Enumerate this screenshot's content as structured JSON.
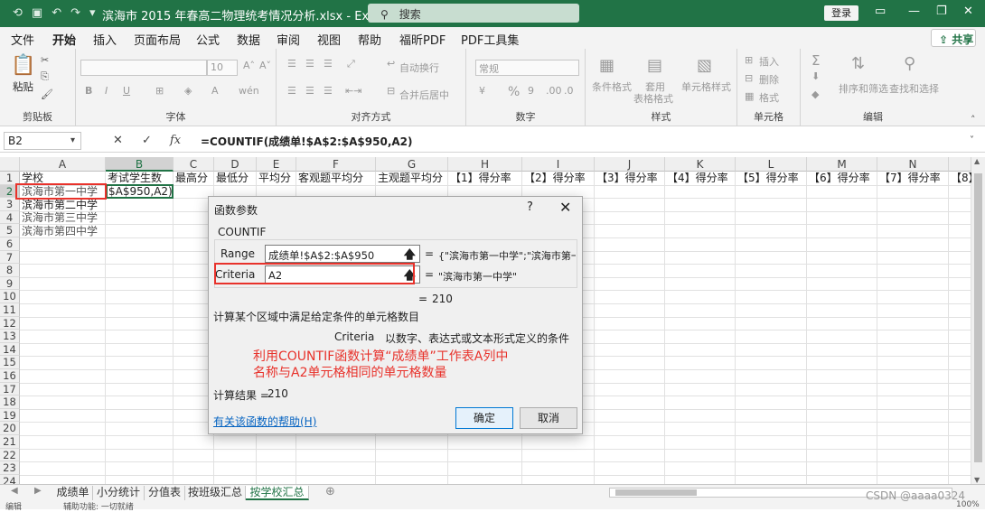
{
  "window": {
    "title": "滨海市 2015 年春高二物理统考情况分析.xlsx  -  Excel",
    "search_placeholder": "搜索",
    "login_label": "登录"
  },
  "menu": [
    "文件",
    "开始",
    "插入",
    "页面布局",
    "公式",
    "数据",
    "审阅",
    "视图",
    "帮助",
    "福昕PDF",
    "PDF工具集"
  ],
  "share_label": "共享",
  "ribbon": {
    "clipboard": {
      "label": "剪贴板",
      "paste": "粘贴"
    },
    "font": {
      "label": "字体",
      "size": "10"
    },
    "alignment": {
      "label": "对齐方式",
      "wrap": "自动换行",
      "merge": "合并后居中"
    },
    "number": {
      "label": "数字",
      "format": "常规"
    },
    "styles": {
      "label": "样式",
      "cond": "条件格式",
      "table1": "套用",
      "table2": "表格格式",
      "cell_styles": "单元格样式"
    },
    "cells": {
      "label": "单元格",
      "insert": "插入",
      "delete": "删除",
      "format": "格式"
    },
    "editing": {
      "label": "编辑",
      "sort": "排序和筛选",
      "find": "查找和选择"
    }
  },
  "formula_bar": {
    "name_box": "B2",
    "fx": "fx",
    "formula": "=COUNTIF(成绩单!$A$2:$A$950,A2)"
  },
  "columns": [
    "A",
    "B",
    "C",
    "D",
    "E",
    "F",
    "G",
    "H",
    "I",
    "J",
    "K",
    "L",
    "M",
    "N",
    ""
  ],
  "headers_row1": [
    "学校",
    "考试学生数",
    "最高分",
    "最低分",
    "平均分",
    "客观题平均分",
    "主观题平均分",
    "【1】得分率",
    "【2】得分率",
    "【3】得分率",
    "【4】得分率",
    "【5】得分率",
    "【6】得分率",
    "【7】得分率",
    "【8】"
  ],
  "rows": [
    "1",
    "2",
    "3",
    "4",
    "5",
    "6",
    "7",
    "8",
    "9",
    "10",
    "11",
    "12",
    "13",
    "14",
    "15",
    "16",
    "17",
    "18",
    "19",
    "20",
    "21",
    "22",
    "23",
    "24"
  ],
  "colA": [
    "滨海市第一中学",
    "滨海市第二中学",
    "滨海市第三中学",
    "滨海市第四中学"
  ],
  "b2_text": "$A$950,A2)",
  "sheet_tabs": [
    "成绩单",
    "小分统计",
    "分值表",
    "按班级汇总",
    "按学校汇总"
  ],
  "status": {
    "left": "编辑",
    "access": "辅助功能: 一切就绪",
    "watermark": "CSDN @aaaa0324",
    "zoom": "100%"
  },
  "dialog": {
    "title": "函数参数",
    "func_name": "COUNTIF",
    "args": [
      {
        "name": "Range",
        "value": "成绩单!$A$2:$A$950",
        "result": "{\"滨海市第一中学\";\"滨海市第一中学"
      },
      {
        "name": "Criteria",
        "value": "A2",
        "result": "\"滨海市第一中学\""
      }
    ],
    "total_eq": "=",
    "total_val": "210",
    "description": "计算某个区域中满足给定条件的单元格数目",
    "arg_help_name": "Criteria",
    "arg_help_text": "以数字、表达式或文本形式定义的条件",
    "note_line1": "利用COUNTIF函数计算“成绩单”工作表A列中",
    "note_line2": "名称与A2单元格相同的单元格数量",
    "result_label": "计算结果 =",
    "result_value": "210",
    "help_link": "有关该函数的帮助(H)",
    "ok": "确定",
    "cancel": "取消"
  }
}
